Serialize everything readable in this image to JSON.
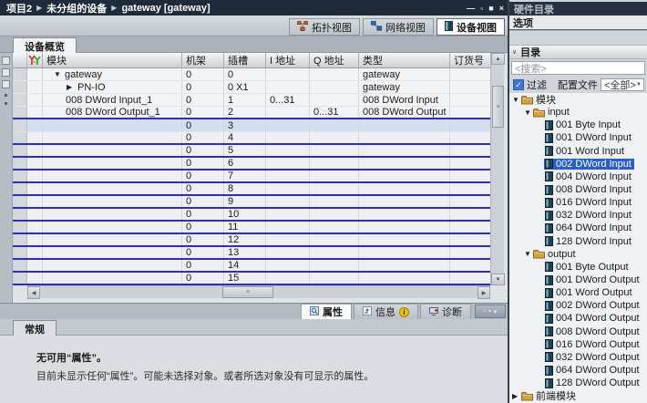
{
  "window": {
    "breadcrumb": [
      "项目2",
      "未分组的设备",
      "gateway [gateway]"
    ],
    "controls": [
      {
        "name": "minimize-button",
        "glyph": "—"
      },
      {
        "name": "restore-button",
        "glyph": "▫"
      },
      {
        "name": "maximize-button",
        "glyph": "■"
      },
      {
        "name": "close-button",
        "glyph": "×"
      }
    ]
  },
  "view_buttons": [
    {
      "label": "拓扑视图",
      "icon": "topology-icon",
      "active": false
    },
    {
      "label": "网络视图",
      "icon": "network-icon",
      "active": false
    },
    {
      "label": "设备视图",
      "icon": "device-icon",
      "active": true
    }
  ],
  "overview_tab": "设备概览",
  "table": {
    "columns": [
      "模块",
      "机架",
      "插槽",
      "I 地址",
      "Q 地址",
      "类型",
      "订货号"
    ],
    "rows": [
      {
        "expander": "▼",
        "indent": 0,
        "module": "gateway",
        "rack": "0",
        "slot": "0",
        "i_addr": "",
        "q_addr": "",
        "type": "gateway",
        "order": ""
      },
      {
        "expander": "▶",
        "indent": 1,
        "module": "PN-IO",
        "rack": "0",
        "slot": "0 X1",
        "i_addr": "",
        "q_addr": "",
        "type": "gateway",
        "order": ""
      },
      {
        "module": "008 DWord Input_1",
        "rack": "0",
        "slot": "1",
        "i_addr": "0...31",
        "q_addr": "",
        "type": "008 DWord Input",
        "order": ""
      },
      {
        "module": "008 DWord Output_1",
        "rack": "0",
        "slot": "2",
        "i_addr": "",
        "q_addr": "0...31",
        "type": "008 DWord Output",
        "order": "",
        "blue_line": true
      },
      {
        "module": "",
        "rack": "0",
        "slot": "3",
        "selected": true
      },
      {
        "module": "",
        "rack": "0",
        "slot": "4",
        "blue_line": true
      },
      {
        "module": "",
        "rack": "0",
        "slot": "5",
        "blue_line": true
      },
      {
        "module": "",
        "rack": "0",
        "slot": "6",
        "blue_line": true
      },
      {
        "module": "",
        "rack": "0",
        "slot": "7",
        "blue_line": true
      },
      {
        "module": "",
        "rack": "0",
        "slot": "8",
        "blue_line": true
      },
      {
        "module": "",
        "rack": "0",
        "slot": "9",
        "blue_line": true
      },
      {
        "module": "",
        "rack": "0",
        "slot": "10",
        "blue_line": true
      },
      {
        "module": "",
        "rack": "0",
        "slot": "11",
        "blue_line": true
      },
      {
        "module": "",
        "rack": "0",
        "slot": "12",
        "blue_line": true
      },
      {
        "module": "",
        "rack": "0",
        "slot": "13",
        "blue_line": true
      },
      {
        "module": "",
        "rack": "0",
        "slot": "14",
        "blue_line": true
      },
      {
        "module": "",
        "rack": "0",
        "slot": "15",
        "blue_line": true
      }
    ]
  },
  "scrollbars": {
    "up": "▲",
    "down": "▼",
    "left": "◀",
    "right": "▶",
    "grip": "≡"
  },
  "inspector": {
    "tabs": [
      {
        "label": "属性",
        "active": true
      },
      {
        "label": "信息",
        "badge": "i",
        "active": false
      },
      {
        "label": "诊断",
        "active": false
      }
    ],
    "general_tab": "常规",
    "message_title": "无可用“属性”。",
    "message_body": "目前未显示任何“属性”。可能未选择对象。或者所选对象没有可显示的属性。"
  },
  "catalog": {
    "title": "硬件目录",
    "options_label": "选项",
    "section_label": "目录",
    "section_chevron": "∨",
    "search_placeholder": "<搜索>",
    "filter_label": "过滤",
    "filter_checked": "✓",
    "profile_label": "配置文件",
    "profile_value": "<全部>",
    "tree": [
      {
        "label": "模块",
        "type": "folder",
        "level": 0,
        "expander": "▼"
      },
      {
        "label": "input",
        "type": "folder",
        "level": 1,
        "expander": "▼"
      },
      {
        "label": "001 Byte Input",
        "type": "module",
        "level": 2
      },
      {
        "label": "001 DWord Input",
        "type": "module",
        "level": 2
      },
      {
        "label": "001 Word Input",
        "type": "module",
        "level": 2
      },
      {
        "label": "002 DWord Input",
        "type": "module",
        "level": 2,
        "selected": true
      },
      {
        "label": "004 DWord Input",
        "type": "module",
        "level": 2
      },
      {
        "label": "008 DWord Input",
        "type": "module",
        "level": 2
      },
      {
        "label": "016 DWord Input",
        "type": "module",
        "level": 2
      },
      {
        "label": "032 DWord Input",
        "type": "module",
        "level": 2
      },
      {
        "label": "064 DWord Input",
        "type": "module",
        "level": 2
      },
      {
        "label": "128 DWord Input",
        "type": "module",
        "level": 2
      },
      {
        "label": "output",
        "type": "folder",
        "level": 1,
        "expander": "▼"
      },
      {
        "label": "001 Byte Output",
        "type": "module",
        "level": 2
      },
      {
        "label": "001 DWord Output",
        "type": "module",
        "level": 2
      },
      {
        "label": "001 Word Output",
        "type": "module",
        "level": 2
      },
      {
        "label": "002 DWord Output",
        "type": "module",
        "level": 2
      },
      {
        "label": "004 DWord Output",
        "type": "module",
        "level": 2
      },
      {
        "label": "008 DWord Output",
        "type": "module",
        "level": 2
      },
      {
        "label": "016 DWord Output",
        "type": "module",
        "level": 2
      },
      {
        "label": "032 DWord Output",
        "type": "module",
        "level": 2
      },
      {
        "label": "064 DWord Output",
        "type": "module",
        "level": 2
      },
      {
        "label": "128 DWord Output",
        "type": "module",
        "level": 2
      },
      {
        "label": "前端模块",
        "type": "folder",
        "level": 0,
        "expander": "▶"
      }
    ]
  },
  "colors": {
    "titlebar": "#1e2b3b",
    "separator_blue": "#2d2dc8",
    "row_selection": "#d3dfee",
    "tree_selection": "#2a5fc6",
    "checkbox_blue": "#3e77d8",
    "badge_yellow": "#f0c000"
  }
}
